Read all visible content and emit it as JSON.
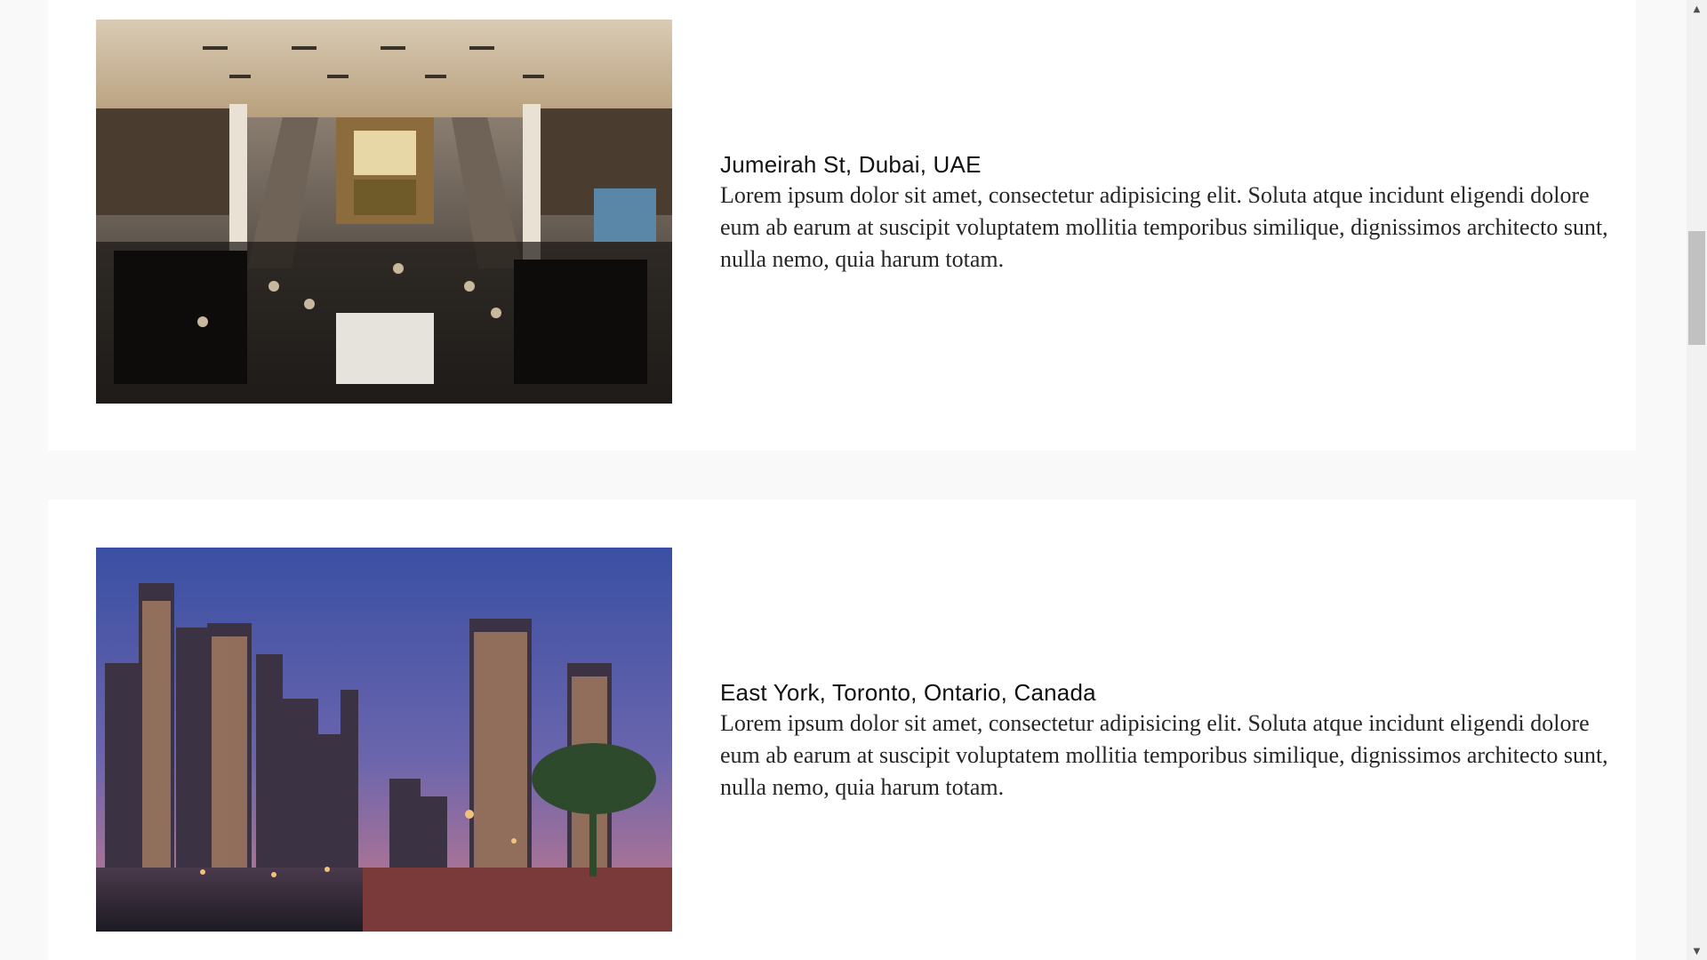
{
  "locations": [
    {
      "title": "Jumeirah St, Dubai, UAE",
      "description": "Lorem ipsum dolor sit amet, consectetur adipisicing elit. Soluta atque incidunt eligendi dolore eum ab earum at suscipit voluptatem mollitia temporibus similique, dignissimos architecto sunt, nulla nemo, quia harum totam.",
      "image": "mall-interior-photo"
    },
    {
      "title": "East York, Toronto, Ontario, Canada",
      "description": "Lorem ipsum dolor sit amet, consectetur adipisicing elit. Soluta atque incidunt eligendi dolore eum ab earum at suscipit voluptatem mollitia temporibus similique, dignissimos architecto sunt, nulla nemo, quia harum totam.",
      "image": "city-marina-skyline-photo"
    }
  ],
  "scrollbar": {
    "up_icon": "triangle-up-icon",
    "down_icon": "triangle-down-icon"
  }
}
